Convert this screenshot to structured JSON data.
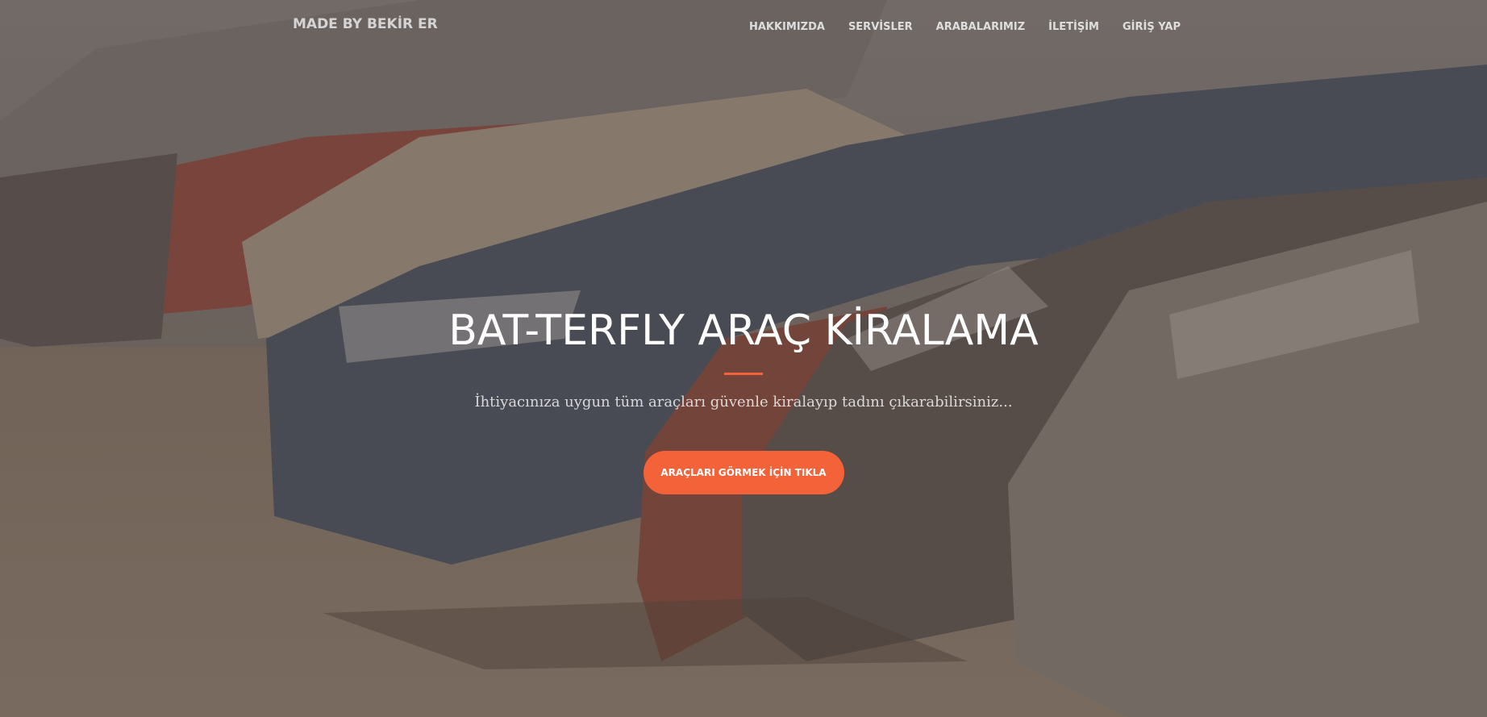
{
  "navbar": {
    "brand": "MADE BY BEKİR ER",
    "items": [
      {
        "label": "HAKKIMIZDA"
      },
      {
        "label": "SERVİSLER"
      },
      {
        "label": "ARABALARIMIZ"
      },
      {
        "label": "İLETİŞİM"
      },
      {
        "label": "GİRİŞ YAP"
      }
    ]
  },
  "hero": {
    "title": "BAT-TERFLY ARAÇ KİRALAMA",
    "subtitle": "İhtiyacınıza uygun tüm araçları güvenle kiralayıp tadını çıkarabilirsiniz...",
    "cta_label": "ARAÇLARI GÖRMEK İÇİN TIKLA",
    "background_icon": "parked-cars-photo"
  },
  "colors": {
    "accent": "#f4623a",
    "overlay": "#5c4d42",
    "text": "#ffffff"
  }
}
